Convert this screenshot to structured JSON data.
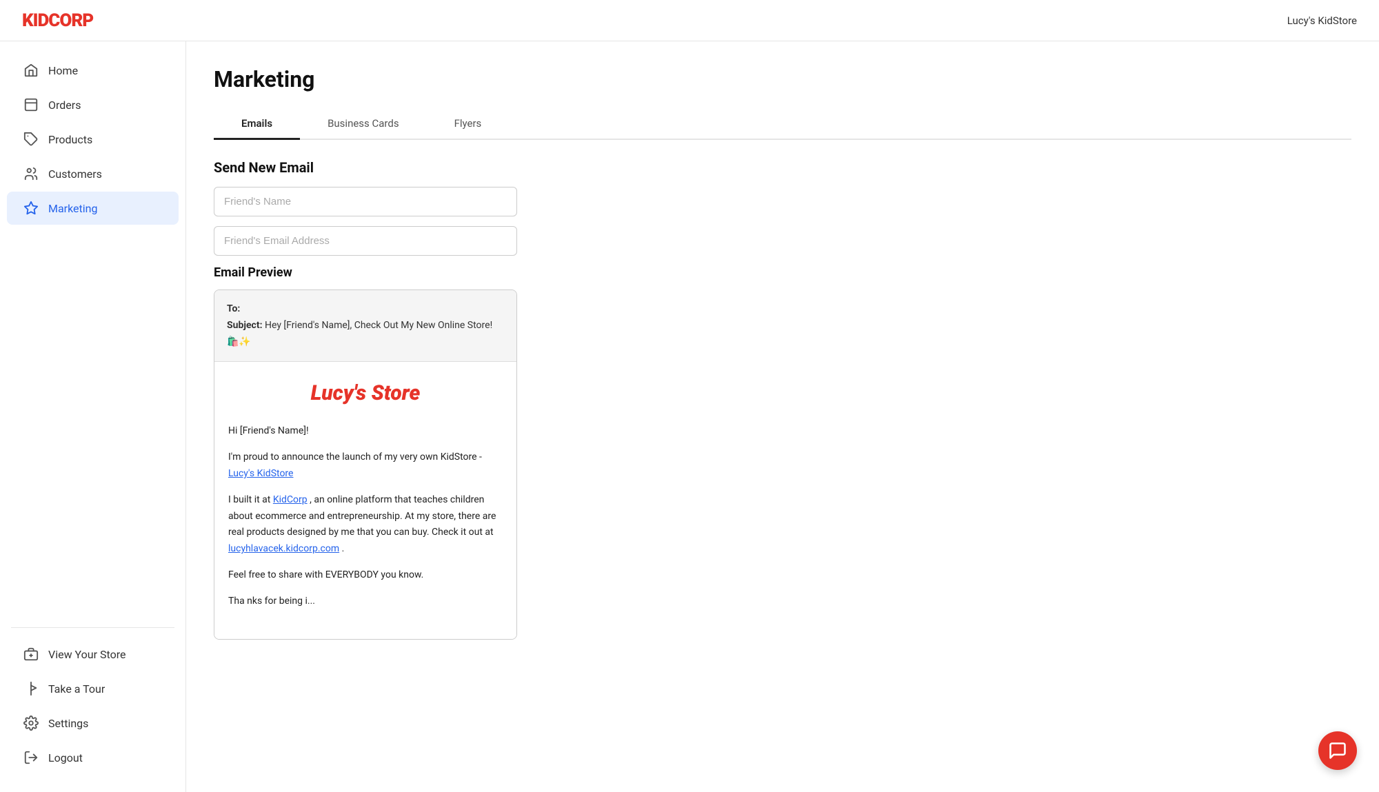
{
  "header": {
    "logo": "KIDCORP",
    "store_name": "Lucy's KidStore"
  },
  "sidebar": {
    "nav_items": [
      {
        "id": "home",
        "label": "Home",
        "icon": "home-icon"
      },
      {
        "id": "orders",
        "label": "Orders",
        "icon": "orders-icon"
      },
      {
        "id": "products",
        "label": "Products",
        "icon": "products-icon"
      },
      {
        "id": "customers",
        "label": "Customers",
        "icon": "customers-icon"
      },
      {
        "id": "marketing",
        "label": "Marketing",
        "icon": "marketing-icon",
        "active": true
      }
    ],
    "bottom_items": [
      {
        "id": "view-store",
        "label": "View Your Store",
        "icon": "store-icon"
      },
      {
        "id": "take-tour",
        "label": "Take a Tour",
        "icon": "tour-icon"
      },
      {
        "id": "settings",
        "label": "Settings",
        "icon": "settings-icon"
      },
      {
        "id": "logout",
        "label": "Logout",
        "icon": "logout-icon"
      }
    ]
  },
  "page": {
    "title": "Marketing",
    "tabs": [
      {
        "id": "emails",
        "label": "Emails",
        "active": true
      },
      {
        "id": "business-cards",
        "label": "Business Cards",
        "active": false
      },
      {
        "id": "flyers",
        "label": "Flyers",
        "active": false
      }
    ],
    "form": {
      "section_title": "Send New Email",
      "name_placeholder": "Friend's Name",
      "email_placeholder": "Friend's Email Address"
    },
    "email_preview": {
      "section_title": "Email Preview",
      "to_label": "To:",
      "to_value": "",
      "subject_label": "Subject:",
      "subject_value": "Hey [Friend's Name], Check Out My New Online Store! 🛍️✨",
      "store_name": "Lucy's Store",
      "greeting": "Hi [Friend's Name]!",
      "para1": "I'm proud to announce the launch of my very own KidStore -",
      "store_link_text": "Lucy's KidStore",
      "para2_start": "I built it at",
      "kidcorp_link": "KidCorp",
      "para2_mid": ", an online platform that teaches children about ecommerce and entrepreneurship. At my store, there are real products designed by me that you can buy. Check it out at",
      "store_url": "lucyhlavacek.kidcorp.com",
      "para2_end": ".",
      "para3": "Feel free to share with EVERYBODY you know.",
      "para4_partial": "Tha nks for being i..."
    }
  }
}
